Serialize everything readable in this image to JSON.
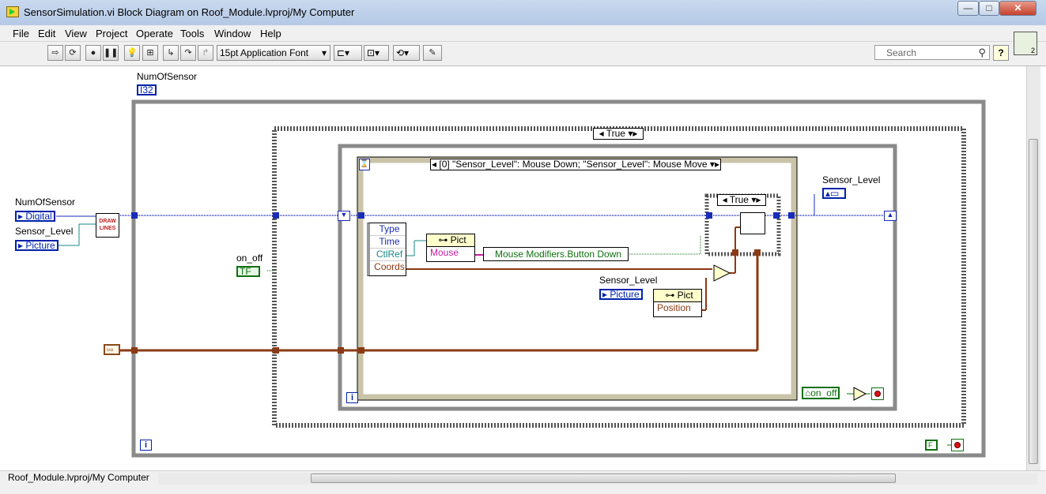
{
  "window": {
    "title": "SensorSimulation.vi Block Diagram on Roof_Module.lvproj/My Computer",
    "minimize": "—",
    "maximize": "□",
    "close": "✕"
  },
  "menu": [
    "File",
    "Edit",
    "View",
    "Project",
    "Operate",
    "Tools",
    "Window",
    "Help"
  ],
  "toolbar": {
    "font": "15pt Application Font",
    "search_placeholder": "Search",
    "help": "?",
    "icon_connector": "2"
  },
  "diagram": {
    "numofsensor_top_label": "NumOfSensor",
    "numofsensor_top_type": "I32",
    "numofsensor_left_label": "NumOfSensor",
    "numofsensor_left_ref": "Digital",
    "sensor_level_left_label": "Sensor_Level",
    "sensor_level_left_ref": "Picture",
    "draw_lines": "DRAW LINES",
    "on_off_label": "on_off",
    "on_off_term": "TF",
    "case_true_outer": "True",
    "event_case": "[0] \"Sensor_Level\": Mouse Down;  \"Sensor_Level\": Mouse Move",
    "event_data": [
      "Type",
      "Time",
      "CtlRef",
      "Coords"
    ],
    "pict_node_1": "Pict",
    "pict_prop_1": "Mouse",
    "mouse_modifiers": "Mouse Modifiers.Button Down",
    "case_true_inner": "True",
    "sensor_level_inner_label": "Sensor_Level",
    "sensor_level_inner_ref": "Picture",
    "pict_node_2": "Pict",
    "pict_prop_2": "Position",
    "sensor_level_right_label": "Sensor_Level",
    "on_off_local": "on_off",
    "false_const": "F",
    "loop_index_outer": "i",
    "loop_index_inner": "i"
  },
  "status": {
    "context": "Roof_Module.lvproj/My Computer"
  }
}
